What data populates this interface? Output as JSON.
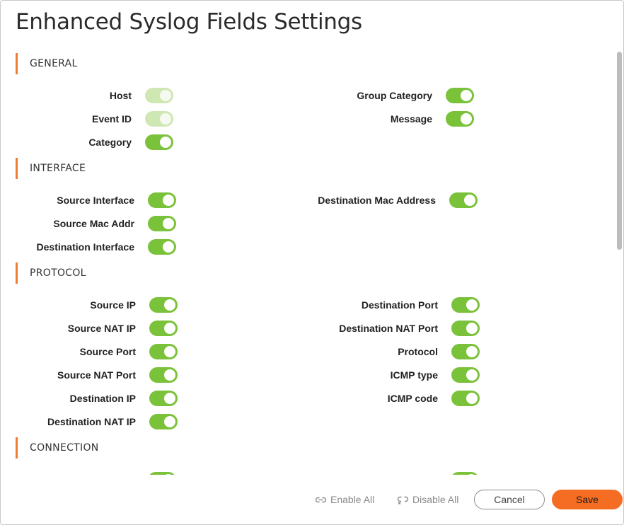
{
  "dialog": {
    "title": "Enhanced Syslog Fields Settings"
  },
  "sections": {
    "general": {
      "header": "GENERAL",
      "left": [
        {
          "label": "Host",
          "enabled": true,
          "disabled_style": true
        },
        {
          "label": "Event ID",
          "enabled": true,
          "disabled_style": true
        },
        {
          "label": "Category",
          "enabled": true
        }
      ],
      "right": [
        {
          "label": "Group Category",
          "enabled": true
        },
        {
          "label": "Message",
          "enabled": true
        }
      ]
    },
    "interface": {
      "header": "INTERFACE",
      "left": [
        {
          "label": "Source Interface",
          "enabled": true
        },
        {
          "label": "Source Mac Addr",
          "enabled": true
        },
        {
          "label": "Destination Interface",
          "enabled": true
        }
      ],
      "right": [
        {
          "label": "Destination Mac Address",
          "enabled": true
        }
      ]
    },
    "protocol": {
      "header": "PROTOCOL",
      "left": [
        {
          "label": "Source IP",
          "enabled": true
        },
        {
          "label": "Source NAT IP",
          "enabled": true
        },
        {
          "label": "Source Port",
          "enabled": true
        },
        {
          "label": "Source NAT Port",
          "enabled": true
        },
        {
          "label": "Destination IP",
          "enabled": true
        },
        {
          "label": "Destination NAT IP",
          "enabled": true
        }
      ],
      "right": [
        {
          "label": "Destination Port",
          "enabled": true
        },
        {
          "label": "Destination NAT Port",
          "enabled": true
        },
        {
          "label": "Protocol",
          "enabled": true
        },
        {
          "label": "ICMP type",
          "enabled": true
        },
        {
          "label": "ICMP code",
          "enabled": true
        }
      ]
    },
    "connection": {
      "header": "CONNECTION"
    }
  },
  "footer": {
    "enable_all": "Enable All",
    "disable_all": "Disable All",
    "cancel": "Cancel",
    "save": "Save"
  },
  "colors": {
    "accent": "#f07a30",
    "toggle_on": "#7bc23b",
    "toggle_disabled": "#cfe8b3",
    "save": "#f56d23"
  },
  "icons": {
    "enable_all": "link-icon",
    "disable_all": "unlink-icon"
  }
}
